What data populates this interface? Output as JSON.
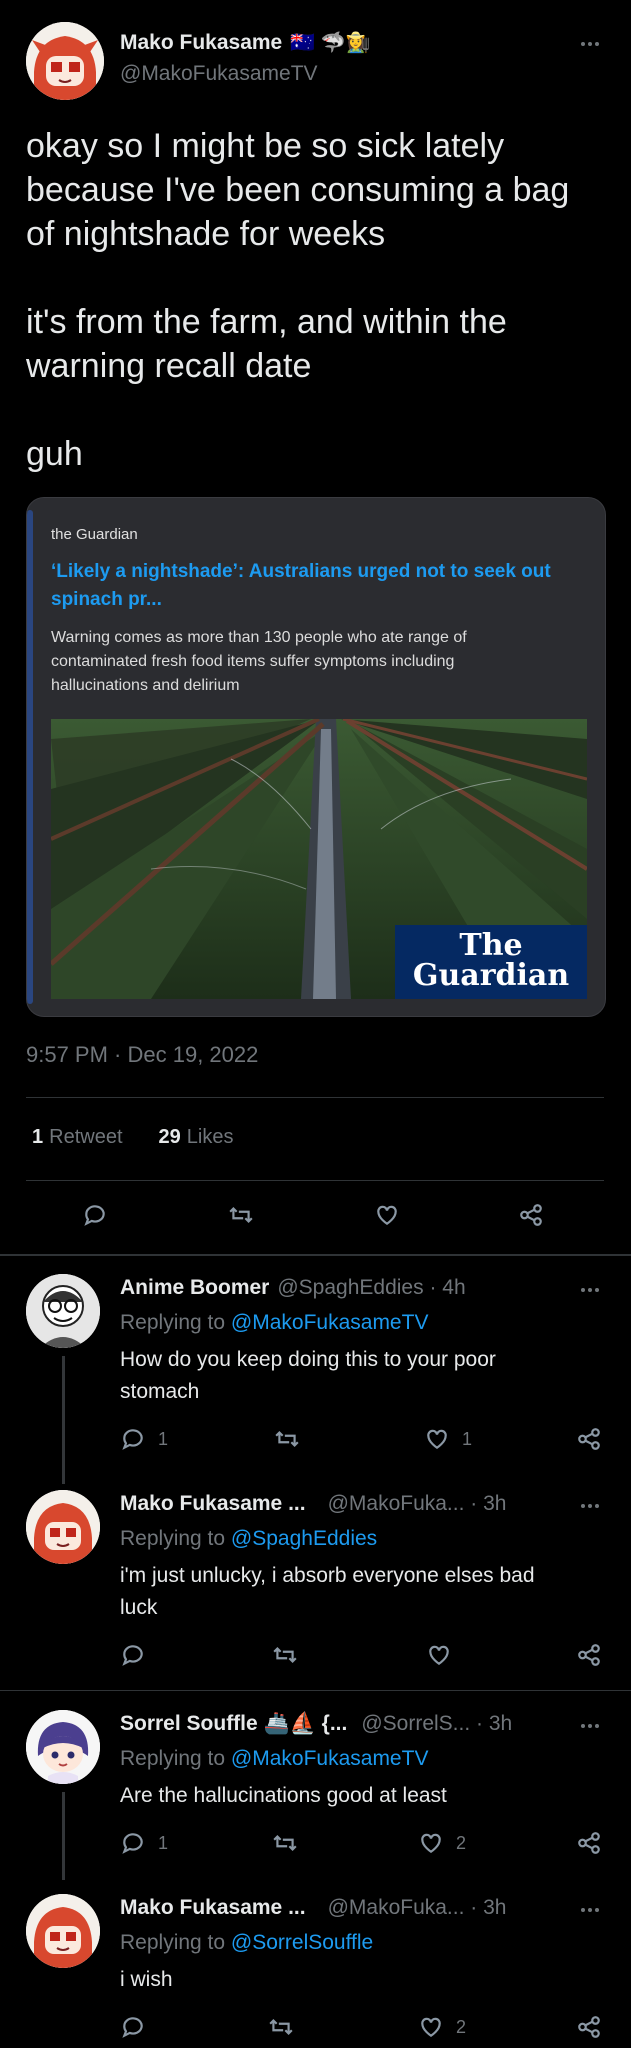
{
  "tweet": {
    "author_name": "Mako Fukasame",
    "author_emoji": "🇦🇺 🦈👩‍🌾",
    "author_handle": "@MakoFukasameTV",
    "text_lines": [
      "okay so I might be so sick lately",
      "because I've been consuming a bag",
      "of nightshade for weeks"
    ],
    "text_p2_lines": [
      "it's from the farm, and within the",
      "warning recall date"
    ],
    "text_p3": "guh",
    "timestamp": "9:57 PM · Dec 19, 2022",
    "retweet_count": "1",
    "retweet_label": "Retweet",
    "like_count": "29",
    "like_label": "Likes"
  },
  "card": {
    "source": "the Guardian",
    "headline_l1": "‘Likely a nightshade’: Australians urged not to seek out",
    "headline_l2": "spinach pr...",
    "desc_l1": "Warning comes as more than 130 people who ate range of",
    "desc_l2": "contaminated fresh food items suffer symptoms including",
    "desc_l3": "hallucinations and delirium",
    "logo_l1": "The",
    "logo_l2": "Guardian"
  },
  "replies": [
    {
      "name": "Anime Boomer",
      "handle": "@SpaghEddies · 4h",
      "replying_prefix": "Replying to ",
      "replying_to": "@MakoFukasameTV",
      "text_l1": "How do you keep doing this to your poor",
      "text_l2": "stomach",
      "replies": "1",
      "likes": "1"
    },
    {
      "name": "Mako Fukasame ...",
      "handle": "@MakoFuka... · 3h",
      "replying_prefix": "Replying to ",
      "replying_to": "@SpaghEddies",
      "text_l1": "i'm just unlucky, i absorb everyone elses bad",
      "text_l2": "luck"
    },
    {
      "name": "Sorrel Souffle 🚢⛵ {...",
      "handle": "@SorrelS... · 3h",
      "replying_prefix": "Replying to ",
      "replying_to": "@MakoFukasameTV",
      "text_l1": "Are the hallucinations good at least",
      "replies": "1",
      "likes": "2"
    },
    {
      "name": "Mako Fukasame ...",
      "handle": "@MakoFuka... · 3h",
      "replying_prefix": "Replying to ",
      "replying_to": "@SorrelSouffle",
      "text_l1": "i wish",
      "likes": "2"
    }
  ],
  "icons": {
    "reply": "reply-icon",
    "retweet": "retweet-icon",
    "like": "heart-icon",
    "share": "share-icon",
    "more": "more-icon"
  },
  "colors": {
    "background": "#000000",
    "link": "#1d9bf0",
    "muted": "#71767b",
    "divider": "#2f3336",
    "card_bg": "#2b2c30"
  }
}
